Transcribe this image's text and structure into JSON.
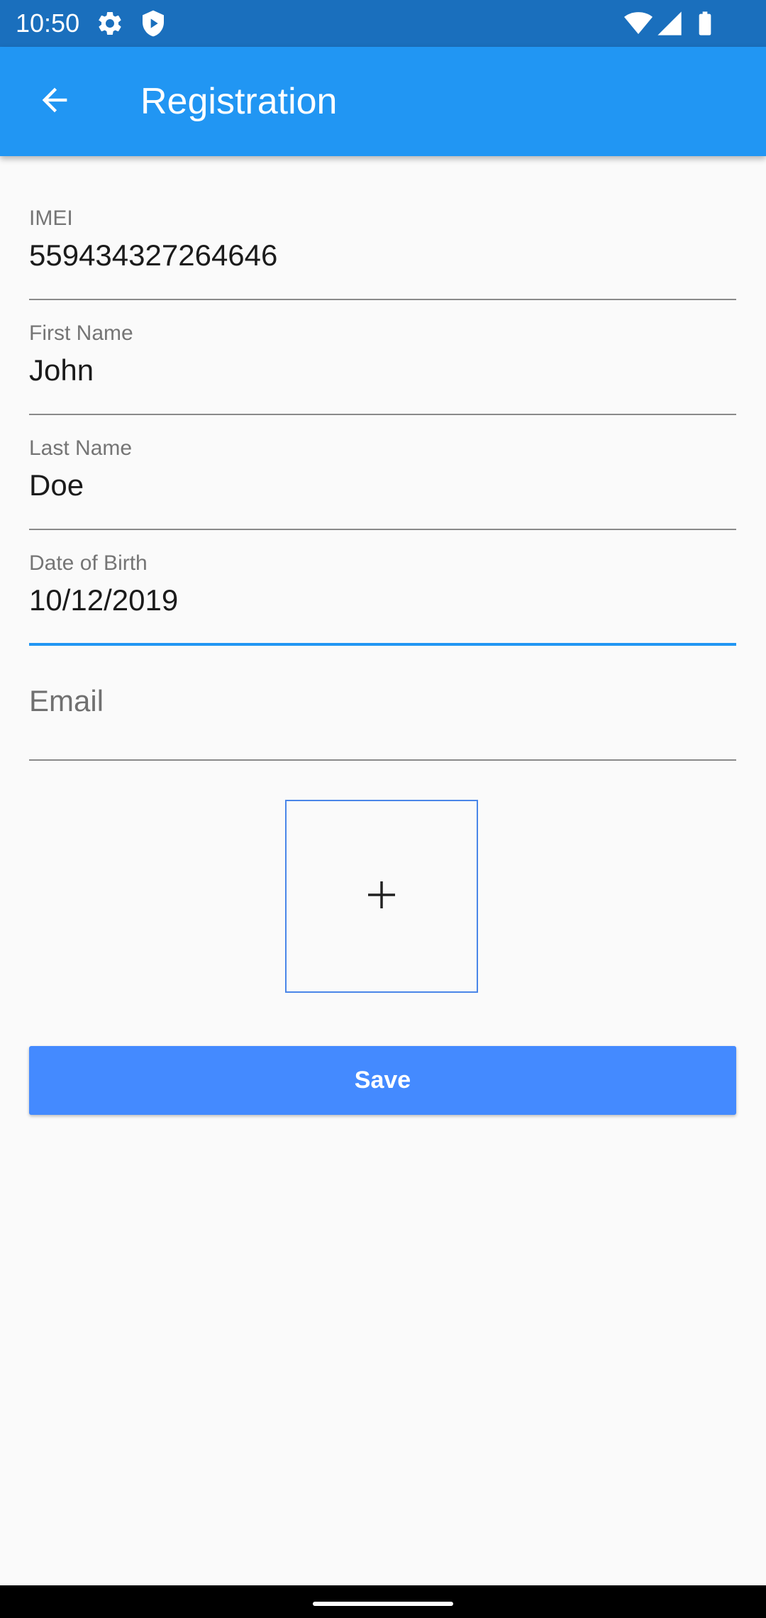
{
  "status_bar": {
    "time": "10:50",
    "icons": [
      "gear-icon",
      "shield-icon",
      "wifi-icon",
      "signal-icon",
      "battery-icon"
    ]
  },
  "app_bar": {
    "title": "Registration",
    "back_icon": "arrow-back-icon",
    "color": "#2196f3"
  },
  "form": {
    "imei": {
      "label": "IMEI",
      "value": "559434327264646"
    },
    "first_name": {
      "label": "First Name",
      "value": "John"
    },
    "last_name": {
      "label": "Last Name",
      "value": "Doe"
    },
    "date_of_birth": {
      "label": "Date of Birth",
      "value": "10/12/2019"
    },
    "email": {
      "placeholder": "Email",
      "value": ""
    },
    "add_photo_icon": "plus-icon",
    "save_label": "Save"
  },
  "colors": {
    "accent": "#2196f3",
    "status_bar": "#1a6fbd",
    "save_button": "#448aff"
  }
}
